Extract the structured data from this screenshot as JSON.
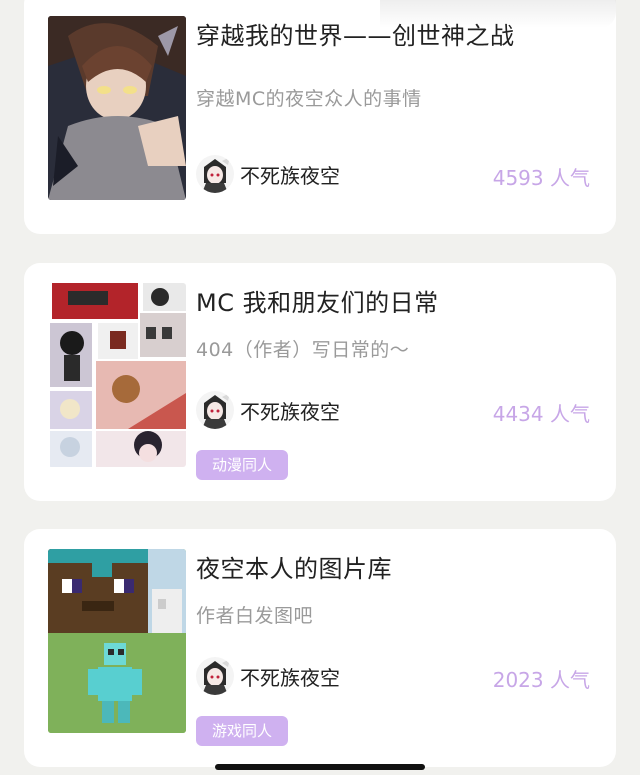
{
  "books": [
    {
      "title": "穿越我的世界——创世神之战",
      "description": "穿越MC的夜空众人的事情",
      "author": "不死族夜空",
      "popularity": "4593 人气",
      "tag": ""
    },
    {
      "title": "MC 我和朋友们的日常",
      "description": "404（作者）写日常的～",
      "author": "不死族夜空",
      "popularity": "4434 人气",
      "tag": "动漫同人"
    },
    {
      "title": "夜空本人的图片库",
      "description": "作者白发图吧",
      "author": "不死族夜空",
      "popularity": "2023 人气",
      "tag": "游戏同人"
    }
  ],
  "colors": {
    "background": "#f1f1ee",
    "card": "#ffffff",
    "popularity": "#c7a6e7",
    "tag_bg": "#cfb1f0"
  },
  "icons": {
    "avatar": "anime-avatar-icon"
  }
}
